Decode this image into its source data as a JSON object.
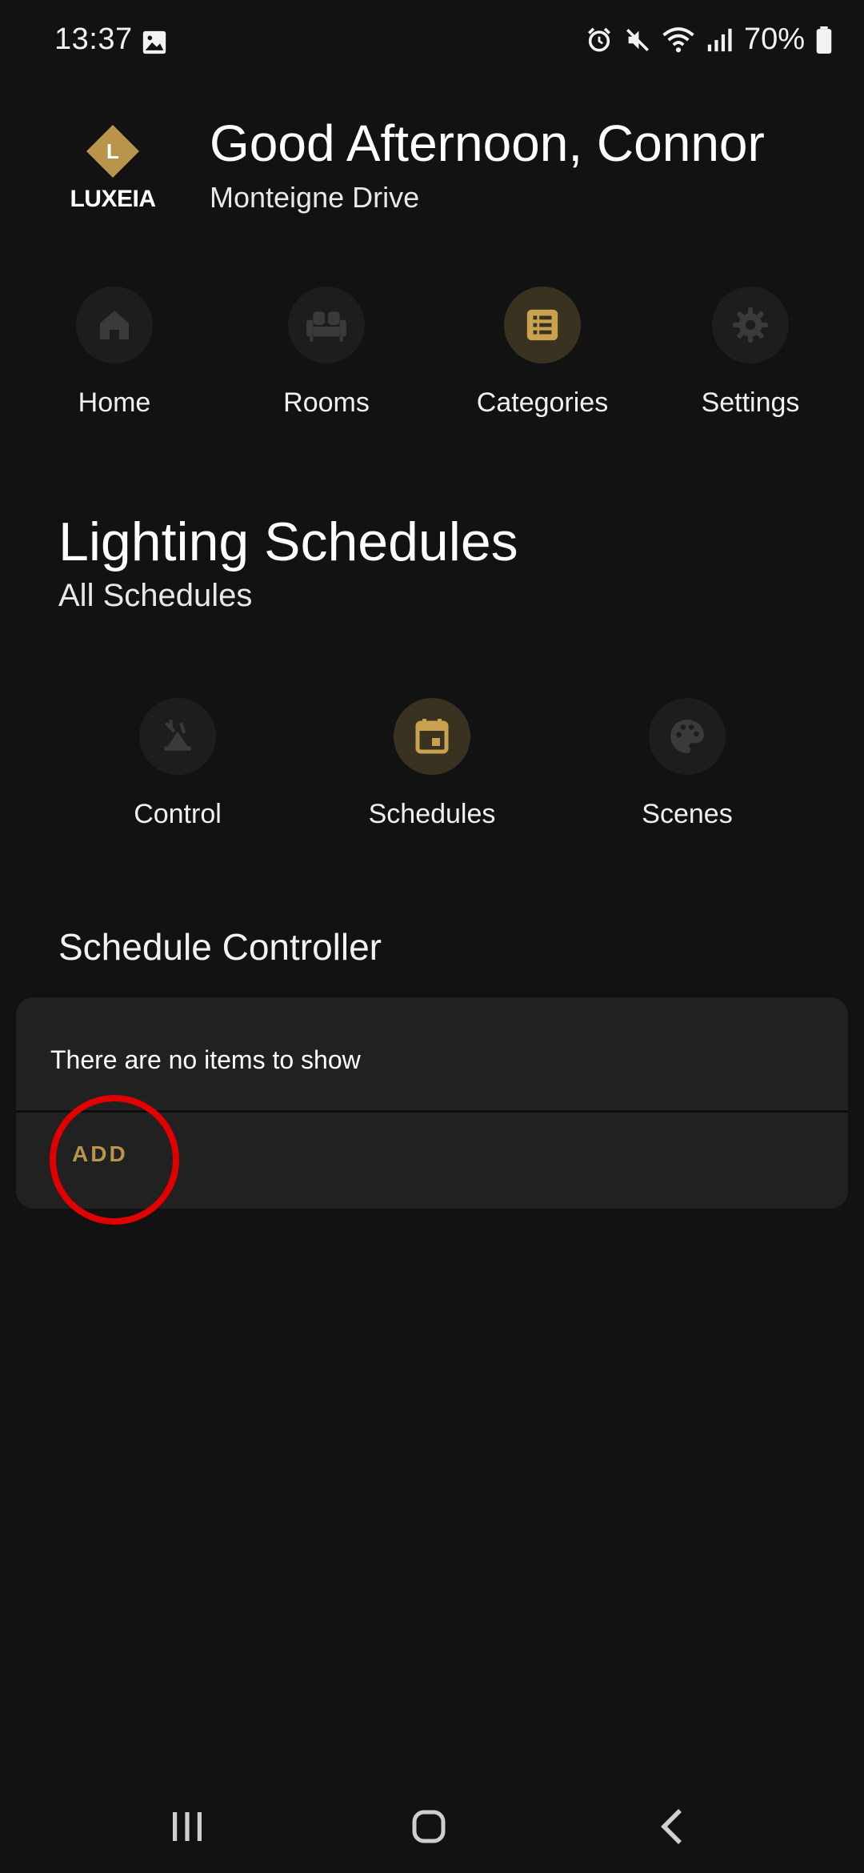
{
  "status_bar": {
    "time": "13:37",
    "battery": "70%"
  },
  "header": {
    "logo_text": "LUXEIA",
    "logo_letter": "L",
    "greeting": "Good Afternoon, Connor",
    "location": "Monteigne Drive"
  },
  "nav": {
    "items": [
      {
        "label": "Home",
        "icon": "home-icon"
      },
      {
        "label": "Rooms",
        "icon": "sofa-icon"
      },
      {
        "label": "Categories",
        "icon": "list-icon",
        "active": true
      },
      {
        "label": "Settings",
        "icon": "gear-icon"
      }
    ]
  },
  "section": {
    "title": "Lighting Schedules",
    "subtitle": "All Schedules"
  },
  "sub_nav": {
    "items": [
      {
        "label": "Control",
        "icon": "lamp-icon"
      },
      {
        "label": "Schedules",
        "icon": "calendar-icon",
        "active": true
      },
      {
        "label": "Scenes",
        "icon": "palette-icon"
      }
    ]
  },
  "controller": {
    "title": "Schedule Controller",
    "empty_message": "There are no items to show",
    "add_label": "ADD"
  },
  "colors": {
    "background": "#121212",
    "card": "#212121",
    "accent": "#b8954a",
    "highlight": "#e00000"
  }
}
